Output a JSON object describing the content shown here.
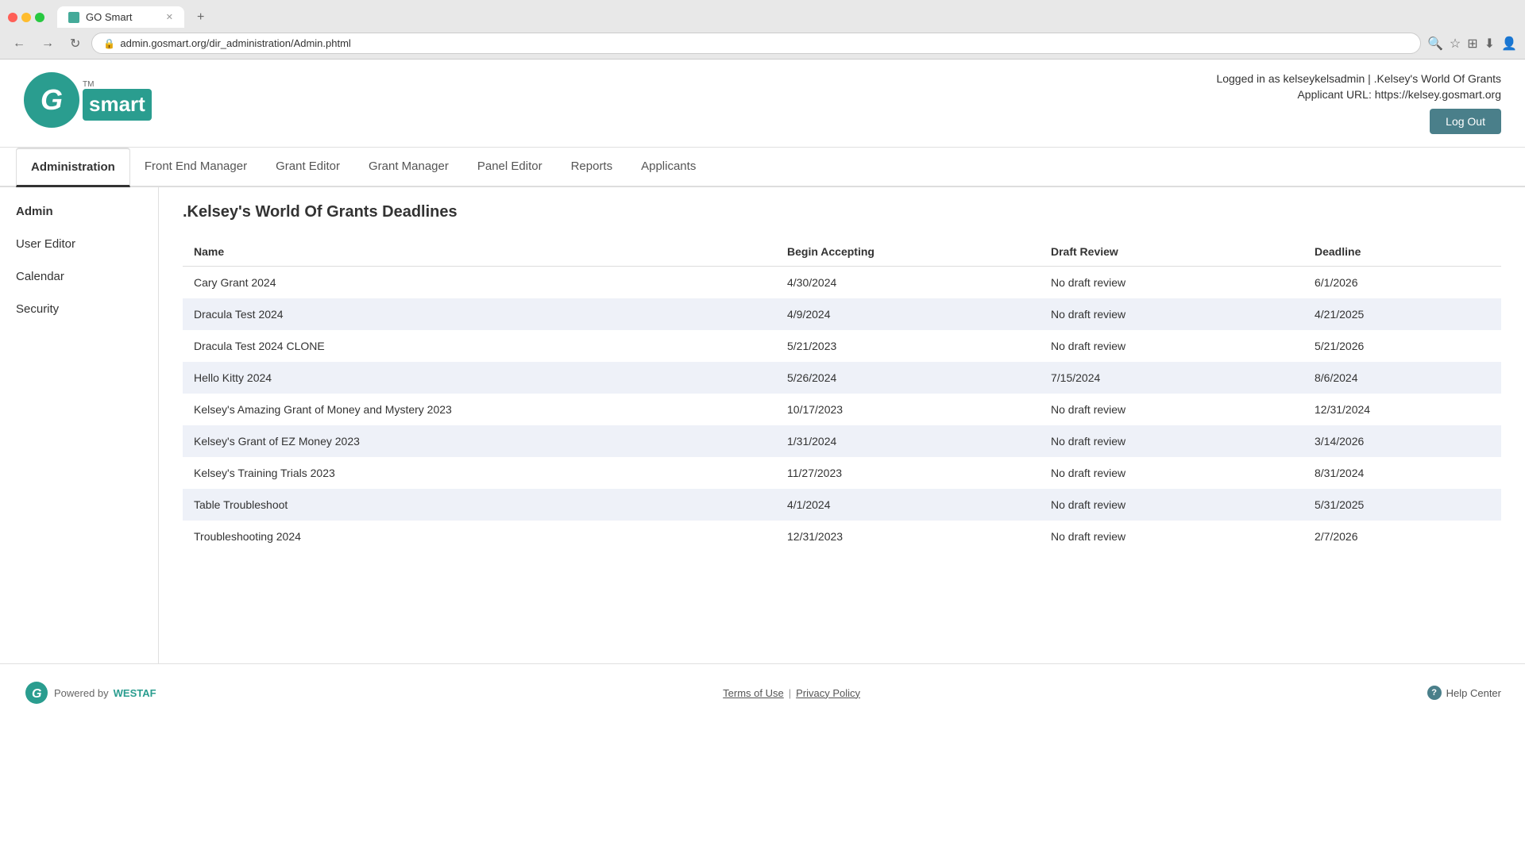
{
  "browser": {
    "tab_title": "GO Smart",
    "url": "admin.gosmart.org/dir_administration/Admin.phtml",
    "new_tab_label": "+"
  },
  "header": {
    "logo_g": "G",
    "logo_smart": "smart",
    "logo_tm": "TM",
    "logged_in_text": "Logged in as kelseykelsadmin | .Kelsey's World Of Grants",
    "applicant_url_label": "Applicant URL: https://kelsey.gosmart.org",
    "logout_label": "Log Out"
  },
  "nav": {
    "tabs": [
      {
        "id": "administration",
        "label": "Administration",
        "active": true
      },
      {
        "id": "front-end-manager",
        "label": "Front End Manager",
        "active": false
      },
      {
        "id": "grant-editor",
        "label": "Grant Editor",
        "active": false
      },
      {
        "id": "grant-manager",
        "label": "Grant Manager",
        "active": false
      },
      {
        "id": "panel-editor",
        "label": "Panel Editor",
        "active": false
      },
      {
        "id": "reports",
        "label": "Reports",
        "active": false
      },
      {
        "id": "applicants",
        "label": "Applicants",
        "active": false
      }
    ]
  },
  "sidebar": {
    "items": [
      {
        "id": "admin",
        "label": "Admin",
        "active": true
      },
      {
        "id": "user-editor",
        "label": "User Editor",
        "active": false
      },
      {
        "id": "calendar",
        "label": "Calendar",
        "active": false
      },
      {
        "id": "security",
        "label": "Security",
        "active": false
      }
    ]
  },
  "content": {
    "title": ".Kelsey's World Of Grants Deadlines",
    "table": {
      "headers": [
        "Name",
        "Begin Accepting",
        "Draft Review",
        "Deadline"
      ],
      "rows": [
        {
          "name": "Cary Grant 2024",
          "begin_accepting": "4/30/2024",
          "draft_review": "No draft review",
          "deadline": "6/1/2026"
        },
        {
          "name": "Dracula Test 2024",
          "begin_accepting": "4/9/2024",
          "draft_review": "No draft review",
          "deadline": "4/21/2025"
        },
        {
          "name": "Dracula Test 2024 CLONE",
          "begin_accepting": "5/21/2023",
          "draft_review": "No draft review",
          "deadline": "5/21/2026"
        },
        {
          "name": "Hello Kitty 2024",
          "begin_accepting": "5/26/2024",
          "draft_review": "7/15/2024",
          "deadline": "8/6/2024"
        },
        {
          "name": "Kelsey's Amazing Grant of Money and Mystery 2023",
          "begin_accepting": "10/17/2023",
          "draft_review": "No draft review",
          "deadline": "12/31/2024"
        },
        {
          "name": "Kelsey's Grant of EZ Money 2023",
          "begin_accepting": "1/31/2024",
          "draft_review": "No draft review",
          "deadline": "3/14/2026"
        },
        {
          "name": "Kelsey's Training Trials 2023",
          "begin_accepting": "11/27/2023",
          "draft_review": "No draft review",
          "deadline": "8/31/2024"
        },
        {
          "name": "Table Troubleshoot",
          "begin_accepting": "4/1/2024",
          "draft_review": "No draft review",
          "deadline": "5/31/2025"
        },
        {
          "name": "Troubleshooting 2024",
          "begin_accepting": "12/31/2023",
          "draft_review": "No draft review",
          "deadline": "2/7/2026"
        }
      ]
    }
  },
  "footer": {
    "powered_by": "Powered by",
    "westaf": "WESTAF",
    "terms_of_use": "Terms of Use",
    "separator": "|",
    "privacy_policy": "Privacy Policy",
    "help_center": "Help Center"
  }
}
